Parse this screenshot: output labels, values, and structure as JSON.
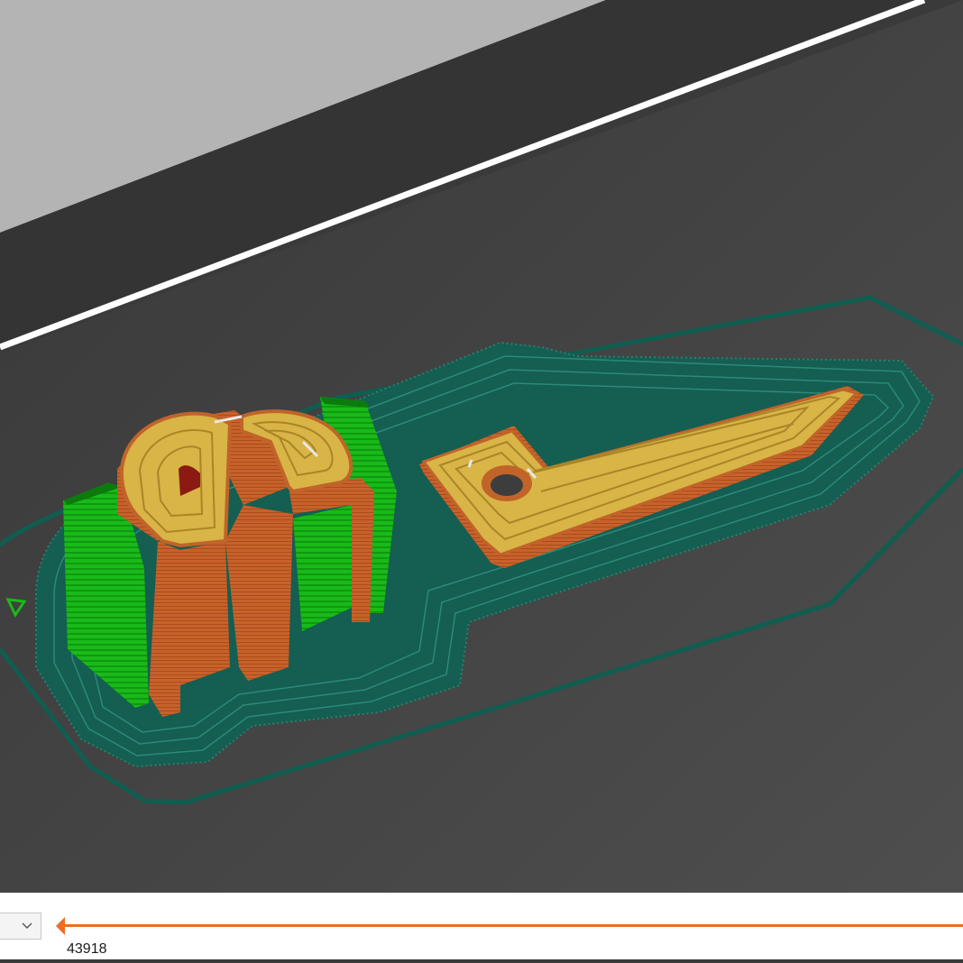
{
  "viewport": {
    "scene": "gcode-preview",
    "colors": {
      "background_far": "#b2b2b2",
      "background_near": "#3a3a3a",
      "bed_surface": "#404040",
      "bed_edge": "#ffffff",
      "skirt": "#0f5e50",
      "brim": "#1a6b5c",
      "perimeter": "#d06b2e",
      "top_infill": "#d9b446",
      "support": "#16b016",
      "overhang": "#8b1a12"
    }
  },
  "bottom_bar": {
    "view_selector": {
      "selected": "",
      "icon": "chevron-down-icon"
    },
    "move_slider": {
      "value": "43918",
      "position_fraction": 0.0,
      "accent_color": "#ea6e24"
    }
  }
}
